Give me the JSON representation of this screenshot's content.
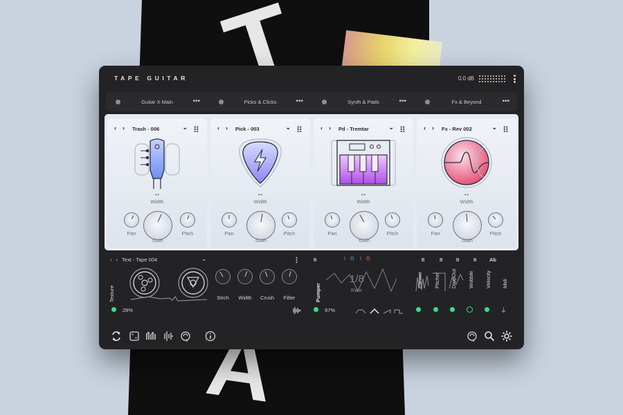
{
  "app": {
    "title": "TAPE GUITAR",
    "output_level": "0.0 dB"
  },
  "tabs": [
    {
      "label": "Guitar X Main"
    },
    {
      "label": "Picks & Clicks"
    },
    {
      "label": "Synth & Pads"
    },
    {
      "label": "Fx & Beyond"
    }
  ],
  "slots": [
    {
      "name": "Trash - 006",
      "icon": "guitar-headstock-icon",
      "width_label": "Width",
      "pan_label": "Pan",
      "gain_label": "Gain",
      "pitch_label": "Pitch"
    },
    {
      "name": "Pick - 003",
      "icon": "guitar-pick-icon",
      "width_label": "Width",
      "pan_label": "Pan",
      "gain_label": "Gain",
      "pitch_label": "Pitch"
    },
    {
      "name": "Pd - Tremtar",
      "icon": "synth-keyboard-icon",
      "width_label": "Width",
      "pan_label": "Pan",
      "gain_label": "Gain",
      "pitch_label": "Pitch"
    },
    {
      "name": "Fx - Rev 002",
      "icon": "fx-wave-circle-icon",
      "width_label": "Width",
      "pan_label": "Pan",
      "gain_label": "Gain",
      "pitch_label": "Pitch"
    }
  ],
  "texture": {
    "preset": "Text - Tape 004",
    "label": "Texture",
    "amount": "28%",
    "knobs": [
      "Strch",
      "Width",
      "Crush",
      "Filter"
    ]
  },
  "pumper": {
    "label": "Pumper",
    "amount": "97%",
    "rate": "1/8",
    "rate_label": "Rate"
  },
  "modulators": [
    {
      "label": "Panner"
    },
    {
      "label": "Pitcher"
    },
    {
      "label": "DropOut"
    },
    {
      "label": "Wobble"
    },
    {
      "label": "Velocity"
    },
    {
      "label": "Midi"
    }
  ],
  "transport_ab": "Ab",
  "colors": {
    "accent_green": "#3ddc84",
    "window_bg": "#232325",
    "slot_bg": "#e6ebf2"
  }
}
